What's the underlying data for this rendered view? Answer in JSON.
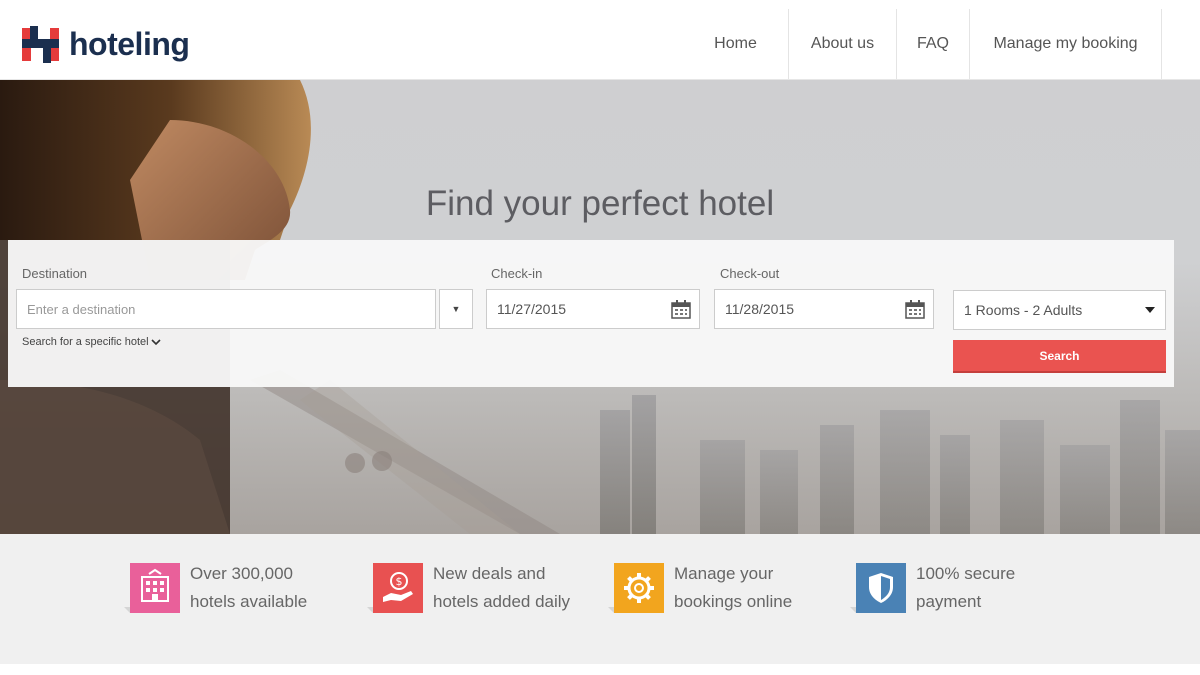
{
  "brand": {
    "name": "hoteling",
    "colors": {
      "red": "#e53b3b",
      "navy": "#1b2f4f"
    }
  },
  "nav": {
    "home": "Home",
    "about": "About us",
    "faq": "FAQ",
    "manage": "Manage my booking"
  },
  "hero": {
    "title": "Find your perfect hotel"
  },
  "search": {
    "destination_label": "Destination",
    "destination_placeholder": "Enter a destination",
    "checkin_label": "Check-in",
    "checkin_value": "11/27/2015",
    "checkout_label": "Check-out",
    "checkout_value": "11/28/2015",
    "specific_hotel": "Search for a specific hotel",
    "rooms_value": "1 Rooms - 2 Adults",
    "search_button": "Search",
    "button_color": "#ea5350"
  },
  "features": [
    {
      "line1": "Over 300,000",
      "line2": "hotels available",
      "icon": "hotel-building-icon",
      "color": "#e9609a"
    },
    {
      "line1": "New deals and",
      "line2": "hotels added daily",
      "icon": "money-hand-icon",
      "color": "#e85151"
    },
    {
      "line1": "Manage your",
      "line2": "bookings online",
      "icon": "gear-icon",
      "color": "#f2a51e"
    },
    {
      "line1": "100% secure",
      "line2": "payment",
      "icon": "shield-icon",
      "color": "#4a82b5"
    }
  ]
}
